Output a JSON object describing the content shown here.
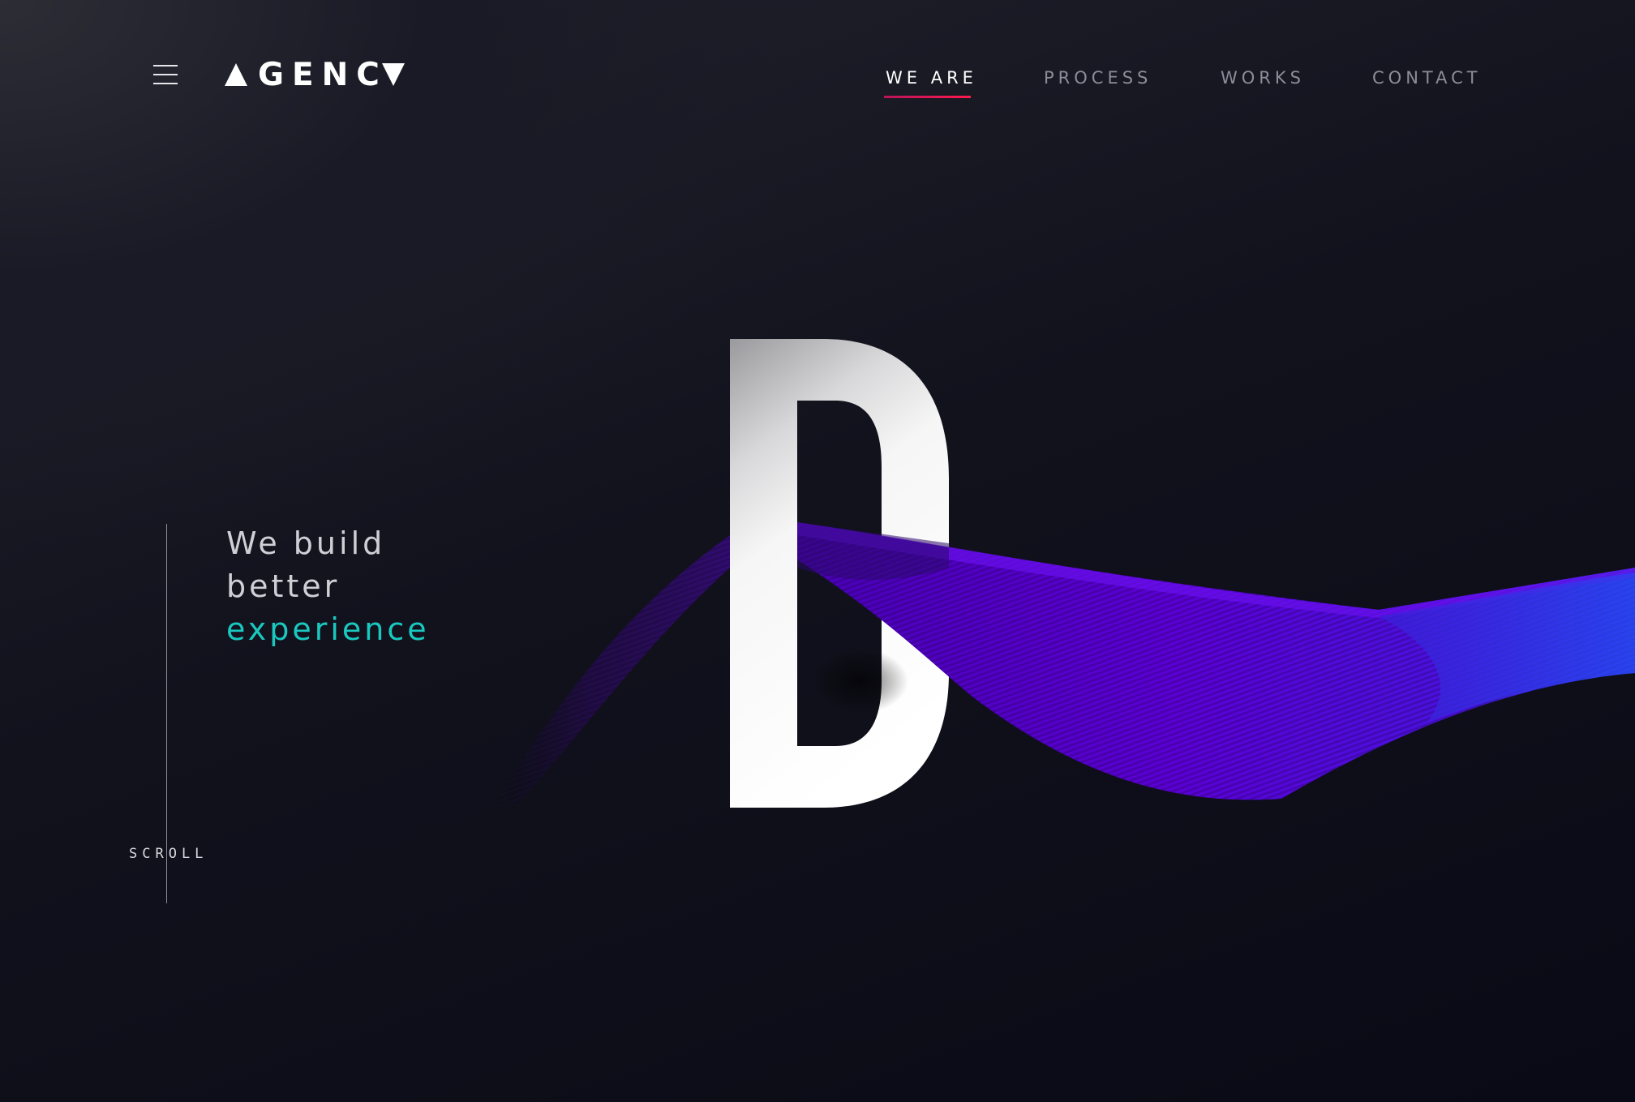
{
  "header": {
    "logo_text": "GENC",
    "menu_icon": "hamburger-menu-icon"
  },
  "nav": {
    "items": [
      {
        "label": "WE ARE",
        "active": true
      },
      {
        "label": "PROCESS",
        "active": false
      },
      {
        "label": "WORKS",
        "active": false
      },
      {
        "label": "CONTACT",
        "active": false
      }
    ],
    "active_underline_color": "#ff1a4d"
  },
  "hero": {
    "line1": "We build",
    "line2": "better",
    "line3": "experience",
    "accent_color": "#19c9c0",
    "big_letter": "D",
    "ribbon_colors": [
      "#3a0a7a",
      "#5a00d8",
      "#2a3ee8"
    ]
  },
  "scroll": {
    "label": "SCROLL"
  },
  "colors": {
    "background": "#0b0b16",
    "text_primary": "#ffffff",
    "text_muted": "#8d8d99"
  }
}
